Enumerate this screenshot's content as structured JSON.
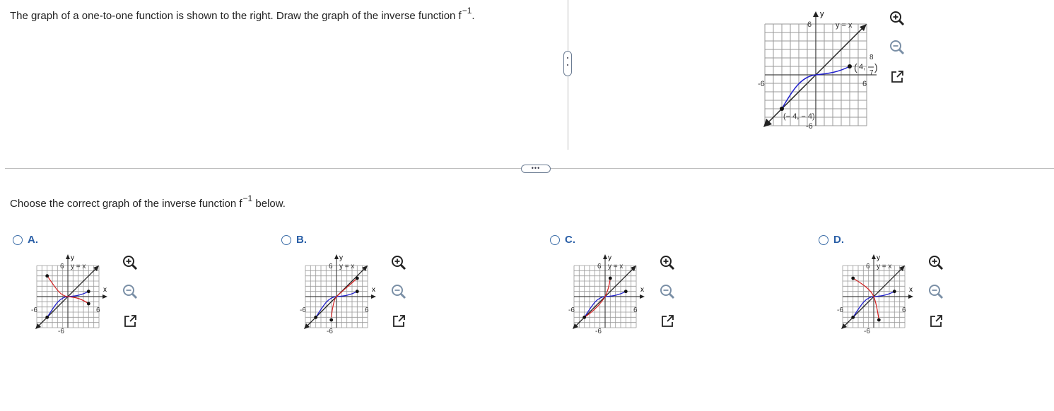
{
  "question": {
    "text": "The graph of a one-to-one function is shown to the right. Draw the graph of the inverse function f",
    "superscript": "−1",
    "end": "."
  },
  "prompt": {
    "text": "Choose the correct graph of the inverse function f",
    "superscript": "−1",
    "end": " below."
  },
  "main_graph": {
    "y_axis_label": "y",
    "y_max_label": "6",
    "y_min_label": "-6",
    "x_min_label": "-6",
    "x_max_label": "6",
    "line_label": "y = x",
    "point_upper_label": "4,",
    "point_upper_frac_num": "8",
    "point_upper_frac_den": "7",
    "point_lower_label": "(− 4, − 4)"
  },
  "options": [
    {
      "letter": "A.",
      "y_axis_label": "y",
      "x_axis_label": "x",
      "y_max_label": "6",
      "y_min_label": "-6",
      "x_min_label": "-6",
      "x_max_label": "6",
      "line_label": "y = x"
    },
    {
      "letter": "B.",
      "y_axis_label": "y",
      "x_axis_label": "x",
      "y_max_label": "6",
      "y_min_label": "-6",
      "x_min_label": "-6",
      "x_max_label": "6",
      "line_label": "y = x"
    },
    {
      "letter": "C.",
      "y_axis_label": "y",
      "x_axis_label": "x",
      "y_max_label": "6",
      "y_min_label": "-6",
      "x_min_label": "-6",
      "x_max_label": "6",
      "line_label": "y = x"
    },
    {
      "letter": "D.",
      "y_axis_label": "y",
      "x_axis_label": "x",
      "y_max_label": "6",
      "y_min_label": "-6",
      "x_min_label": "-6",
      "x_max_label": "6",
      "line_label": "y = x"
    }
  ],
  "icons": {
    "zoom_in": "zoom-in-icon",
    "zoom_out": "zoom-out-icon",
    "popout": "popout-icon",
    "more": "more-icon"
  },
  "colors": {
    "f_curve": "#1f1fcc",
    "inverse_curve": "#d42020",
    "radio": "#3d6ea8",
    "label": "#2a5fa7",
    "grid": "#9a9a9a"
  }
}
